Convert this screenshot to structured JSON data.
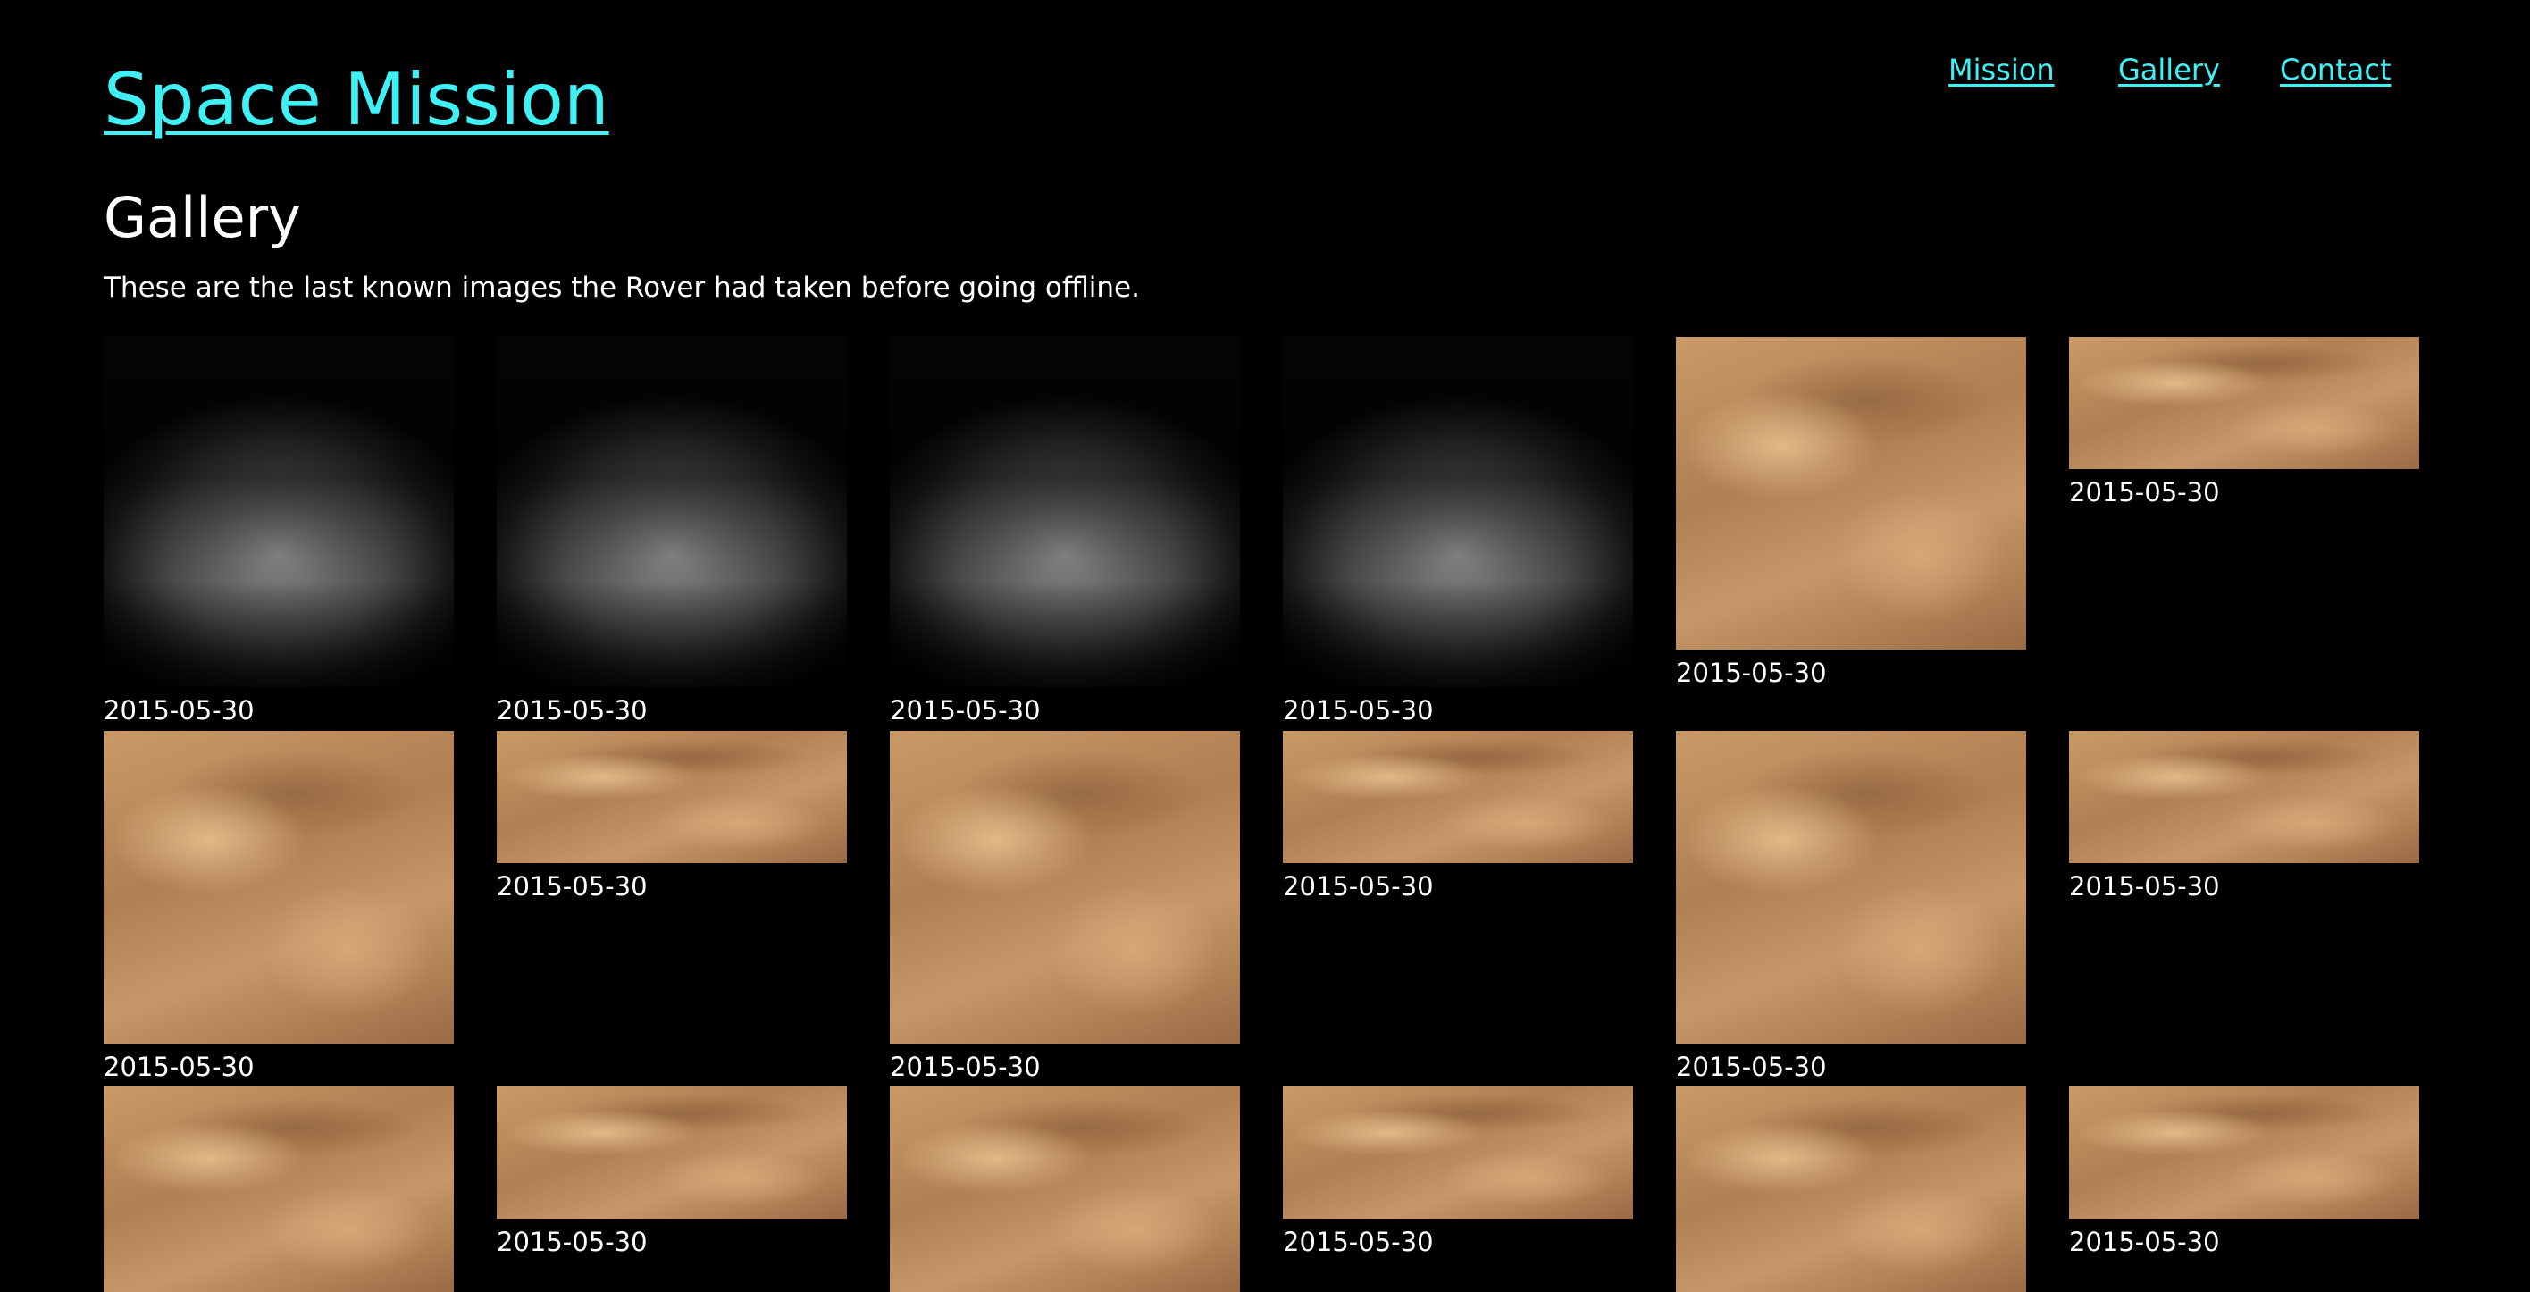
{
  "header": {
    "site_title": "Space Mission",
    "nav": [
      {
        "label": "Mission"
      },
      {
        "label": "Gallery"
      },
      {
        "label": "Contact"
      }
    ]
  },
  "main": {
    "title": "Gallery",
    "intro": "These are the last known images the Rover had taken before going offline."
  },
  "gallery": {
    "images": [
      {
        "caption": "2015-05-30",
        "style": "grayscale"
      },
      {
        "caption": "2015-05-30",
        "style": "grayscale"
      },
      {
        "caption": "2015-05-30",
        "style": "grayscale"
      },
      {
        "caption": "2015-05-30",
        "style": "grayscale"
      },
      {
        "caption": "2015-05-30",
        "style": "color"
      },
      {
        "caption": "2015-05-30",
        "style": "color"
      },
      {
        "caption": "2015-05-30",
        "style": "color"
      },
      {
        "caption": "2015-05-30",
        "style": "color"
      },
      {
        "caption": "2015-05-30",
        "style": "color"
      },
      {
        "caption": "2015-05-30",
        "style": "color"
      },
      {
        "caption": "2015-05-30",
        "style": "color"
      },
      {
        "caption": "2015-05-30",
        "style": "color"
      },
      {
        "caption": "",
        "style": "color"
      },
      {
        "caption": "2015-05-30",
        "style": "color"
      },
      {
        "caption": "",
        "style": "color"
      },
      {
        "caption": "2015-05-30",
        "style": "color"
      },
      {
        "caption": "",
        "style": "color"
      },
      {
        "caption": "2015-05-30",
        "style": "color"
      }
    ]
  },
  "colors": {
    "background": "#000000",
    "link": "#3ff0f5",
    "text": "#ffffff"
  }
}
